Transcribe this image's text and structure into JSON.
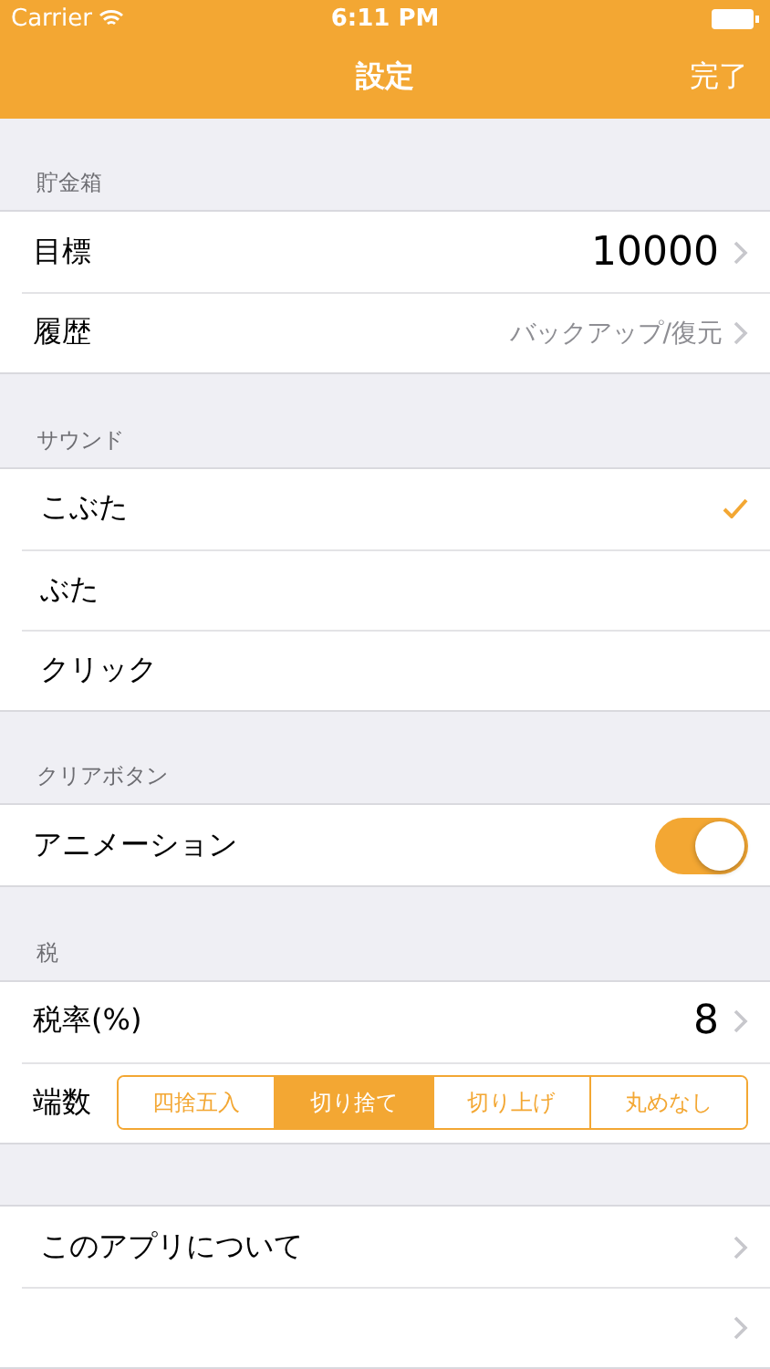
{
  "status_bar": {
    "carrier": "Carrier",
    "time": "6:11 PM"
  },
  "nav": {
    "title": "設定",
    "done": "完了"
  },
  "sections": [
    {
      "header": "貯金箱",
      "rows": [
        {
          "kind": "value",
          "label": "目標",
          "value": "10000"
        },
        {
          "kind": "detail",
          "label": "履歴",
          "value": "バックアップ/復元"
        }
      ]
    },
    {
      "header": "サウンド",
      "rows": [
        {
          "kind": "check",
          "label": "こぶた",
          "selected": true
        },
        {
          "kind": "check",
          "label": "ぶた",
          "selected": false
        },
        {
          "kind": "check",
          "label": "クリック",
          "selected": false
        }
      ]
    },
    {
      "header": "クリアボタン",
      "rows": [
        {
          "kind": "switch",
          "label": "アニメーション",
          "on": true
        }
      ]
    },
    {
      "header": "税",
      "rows": [
        {
          "kind": "value",
          "label": "税率(%)",
          "value": "8"
        },
        {
          "kind": "segmented",
          "label": "端数",
          "options": [
            {
              "label": "四捨五入",
              "selected": false
            },
            {
              "label": "切り捨て",
              "selected": true
            },
            {
              "label": "切り上げ",
              "selected": false
            },
            {
              "label": "丸めなし",
              "selected": false
            }
          ]
        }
      ]
    },
    {
      "rows": [
        {
          "kind": "link",
          "label": "このアプリについて"
        },
        {
          "kind": "link"
        }
      ]
    }
  ]
}
